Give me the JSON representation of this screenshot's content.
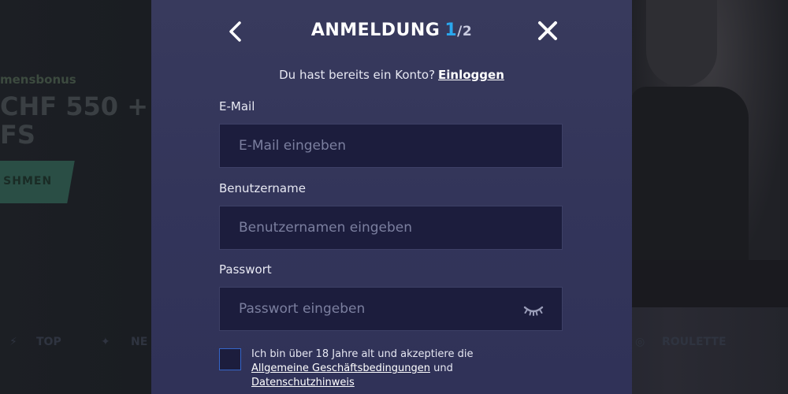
{
  "background": {
    "promo_small": "mensbonus",
    "promo_line1": "CHF 550 +",
    "promo_line2": "FS",
    "promo_button": "SHMEN",
    "nav_items": [
      "TOP",
      "NE",
      "ROULETTE"
    ]
  },
  "header": {
    "title": "ANMELDUNG",
    "step_current": "1",
    "step_total": "/2",
    "back_icon": "chevron-left-icon",
    "close_icon": "close-icon"
  },
  "login_prompt": {
    "text": "Du hast bereits ein Konto?",
    "link": "Einloggen"
  },
  "form": {
    "email": {
      "label": "E-Mail",
      "placeholder": "E-Mail eingeben",
      "value": ""
    },
    "username": {
      "label": "Benutzername",
      "placeholder": "Benutzernamen eingeben",
      "value": ""
    },
    "password": {
      "label": "Passwort",
      "placeholder": "Passwort eingeben",
      "value": "",
      "toggle_icon": "eye-closed-icon"
    }
  },
  "terms": {
    "checked": false,
    "text_before": "Ich bin über 18 Jahre alt und akzeptiere die",
    "agb_link": "Allgemeine Geschäftsbedingungen",
    "conjunction": "und",
    "privacy_link": "Datenschutzhinweis"
  },
  "colors": {
    "modal_bg": "#35375b",
    "input_bg": "#1c1d3d",
    "accent": "#2aa7ee",
    "checkbox_border": "#3566c8"
  }
}
